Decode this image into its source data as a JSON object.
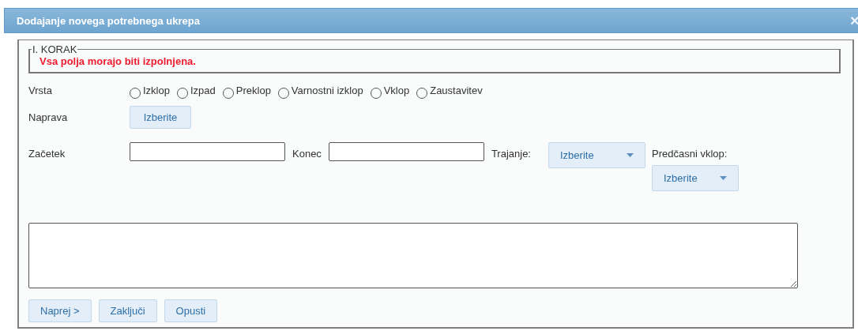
{
  "window": {
    "title": "Dodajanje novega potrebnega ukrepa",
    "close": "×"
  },
  "step": {
    "legend": "I. KORAK",
    "message": "Vsa polja morajo biti izpolnjena."
  },
  "type": {
    "label": "Vrsta",
    "options": [
      {
        "label": "Izklop",
        "selected": false
      },
      {
        "label": "Izpad",
        "selected": false
      },
      {
        "label": "Preklop",
        "selected": false
      },
      {
        "label": "Varnostni izklop",
        "selected": false
      },
      {
        "label": "Vklop",
        "selected": false
      },
      {
        "label": "Zaustavitev",
        "selected": false
      }
    ]
  },
  "device": {
    "label": "Naprava",
    "button": "Izberite"
  },
  "start": {
    "label": "Začetek"
  },
  "end": {
    "label": "Konec"
  },
  "duration": {
    "label": "Trajanje:",
    "dropdown": "Izberite"
  },
  "early": {
    "label": "Predčasni vklop:",
    "dropdown": "Izberite"
  },
  "buttons": [
    "Naprej >",
    "Zaključi",
    "Opusti"
  ]
}
